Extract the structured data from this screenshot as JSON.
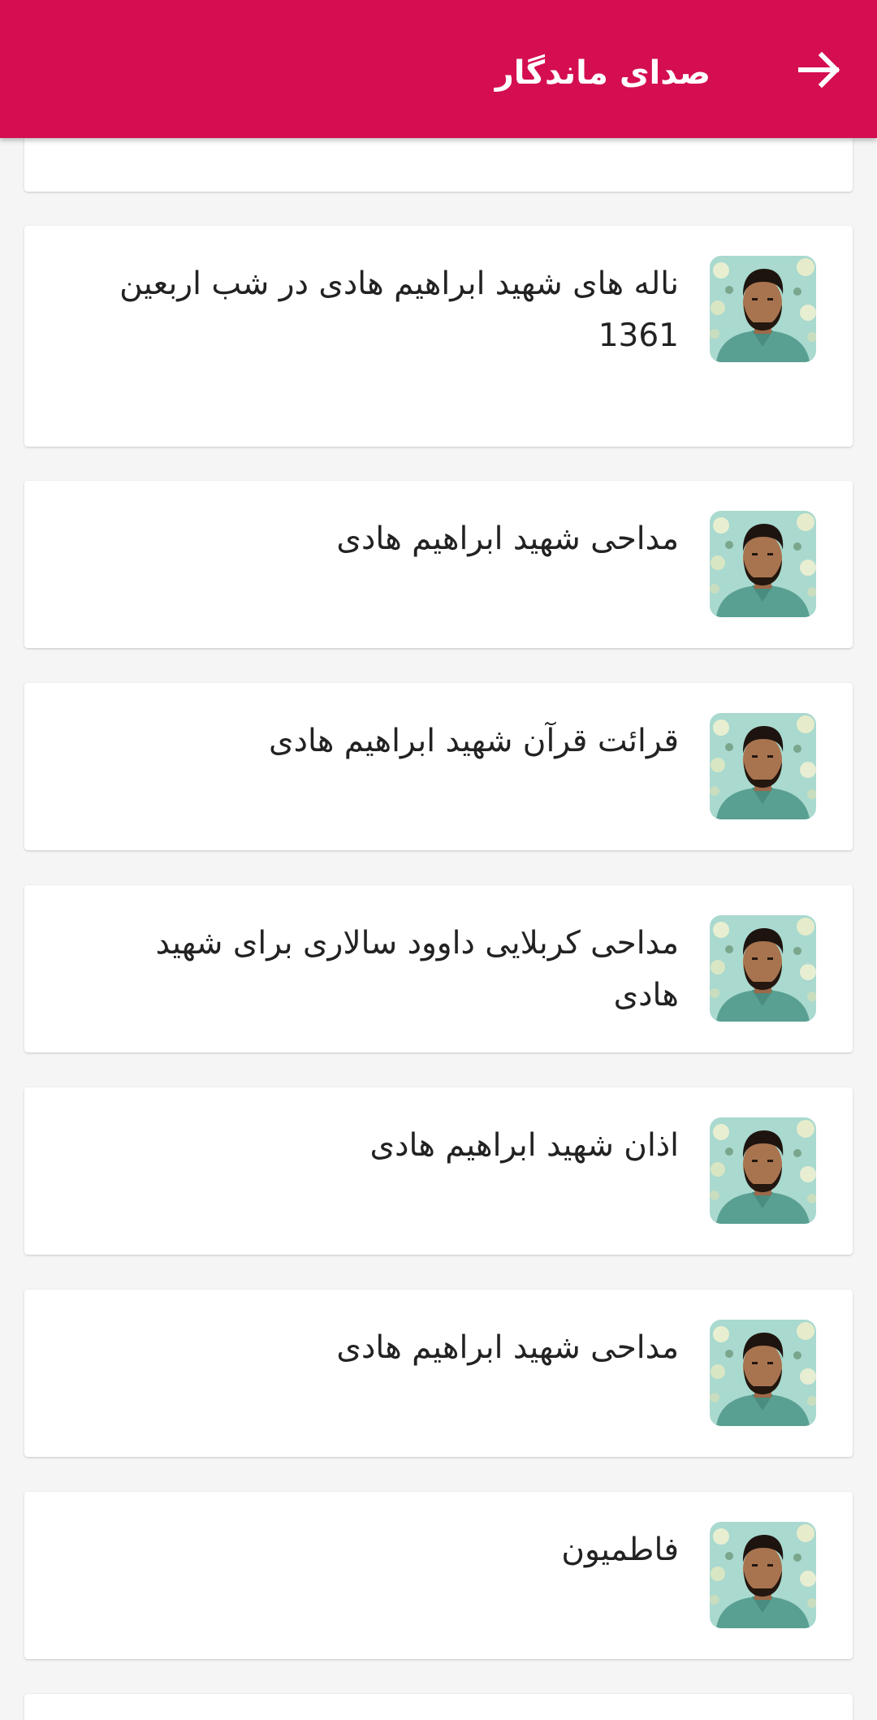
{
  "app_bar": {
    "title": "صدای ماندگار",
    "back_icon": "arrow-forward-icon",
    "background": "#d40e50"
  },
  "items": [
    {
      "title": "ناله های شهید ابراهیم هادی در شب اربعین 1361",
      "thumbnail": "portrait-thumbnail"
    },
    {
      "title": "مداحی شهید ابراهیم هادی",
      "thumbnail": "portrait-thumbnail"
    },
    {
      "title": "قرائت قرآن شهید ابراهیم هادی",
      "thumbnail": "portrait-thumbnail"
    },
    {
      "title": "مداحی کربلایی داوود سالاری برای شهید هادی",
      "thumbnail": "portrait-thumbnail"
    },
    {
      "title": "اذان شهید ابراهیم هادی",
      "thumbnail": "portrait-thumbnail"
    },
    {
      "title": "مداحی شهید ابراهیم هادی",
      "thumbnail": "portrait-thumbnail"
    },
    {
      "title": "فاطمیون",
      "thumbnail": "portrait-thumbnail"
    }
  ]
}
